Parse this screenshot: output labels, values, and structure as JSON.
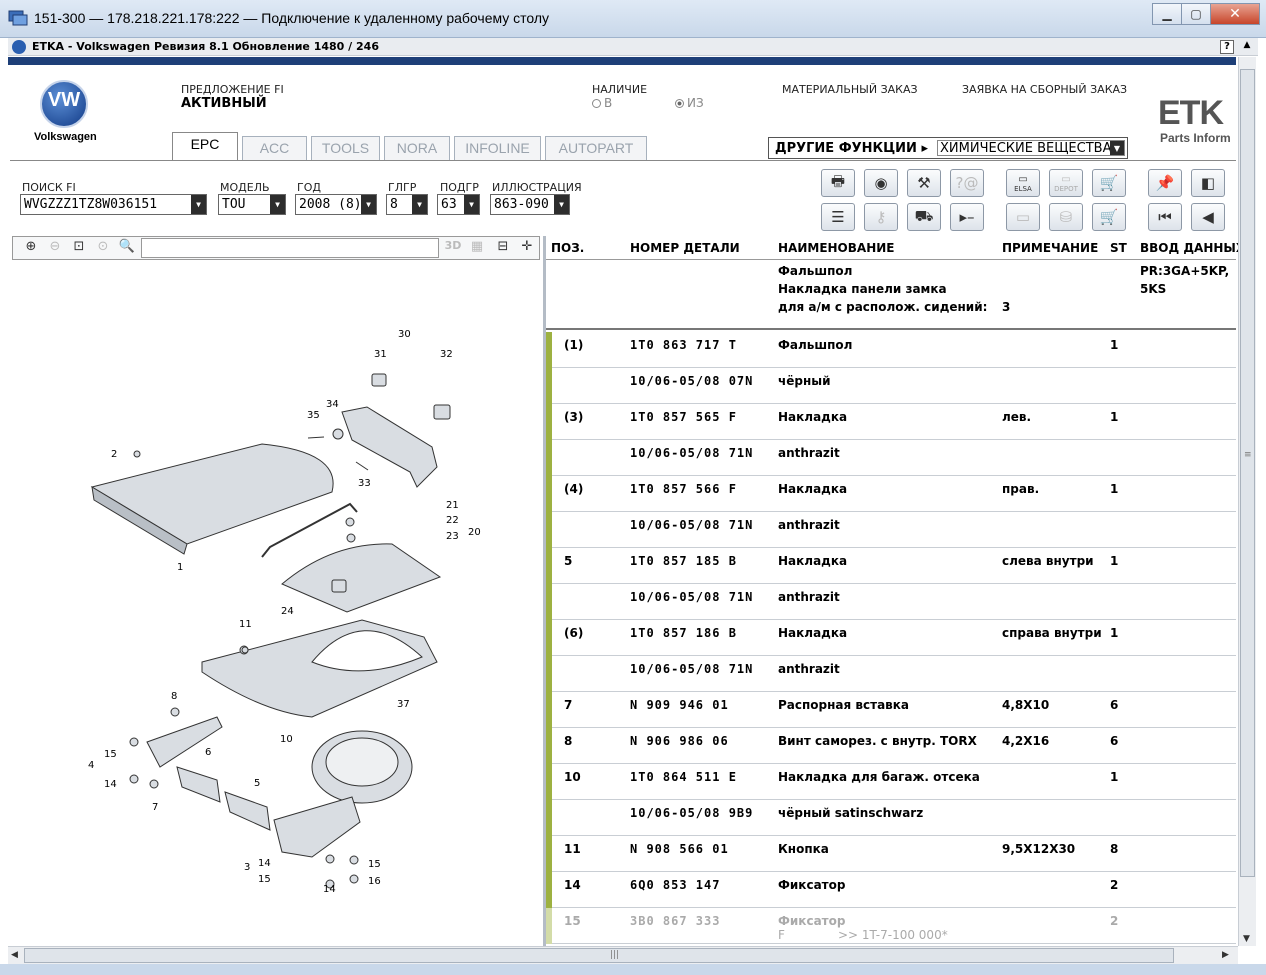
{
  "window": {
    "title": "151-300 — 178.218.221.178:222 — Подключение к удаленному рабочему столу",
    "minimize": "▁",
    "maximize": "▢",
    "close": "✕"
  },
  "app": {
    "title": "ETKA - Volkswagen Ревизия 8.1 Обновление 1480 / 246",
    "help": "?",
    "brand": "Volkswagen",
    "logo_letters": "VW",
    "etk_logo": "ETK",
    "etk_sub": "Parts Inform",
    "accent_color": "#1e3f78",
    "row_marker_color": "#9db141"
  },
  "header": {
    "offer_label": "ПРЕДЛОЖЕНИЕ FI",
    "offer_value": "АКТИВНЫЙ",
    "availability_label": "НАЛИЧИЕ",
    "availability_in": "В",
    "availability_from": "ИЗ",
    "material_order": "МАТЕРИАЛЬНЫЙ ЗАКАЗ",
    "assembly_order": "ЗАЯВКА НА СБОРНЫЙ ЗАКАЗ"
  },
  "tabs": [
    {
      "label": "EPC"
    },
    {
      "label": "ACC"
    },
    {
      "label": "TOOLS"
    },
    {
      "label": "NORA"
    },
    {
      "label": "INFOLINE"
    },
    {
      "label": "AUTOPART"
    }
  ],
  "other_functions": {
    "label": "ДРУГИЕ ФУНКЦИИ",
    "selected": "ХИМИЧЕСКИЕ ВЕЩЕСТВА"
  },
  "filters": {
    "search_fi_label": "ПОИСК FI",
    "search_fi_value": "WVGZZZ1TZ8W036151",
    "model_label": "МОДЕЛЬ",
    "model_value": "TOU",
    "year_label": "ГОД",
    "year_value": "2008 (8)",
    "main_group_label": "ГЛГР",
    "main_group_value": "8",
    "subgroup_label": "ПОДГР",
    "subgroup_value": "63",
    "illustration_label": "ИЛЛЮСТРАЦИЯ",
    "illustration_value": "863-090"
  },
  "toolbar": {
    "elsa": "ELSA",
    "depot": "DEPOT"
  },
  "illustration_toolbar": {
    "label_3d": "3D"
  },
  "table": {
    "columns": [
      "ПОЗ.",
      "НОМЕР ДЕТАЛИ",
      "НАИМЕНОВАНИЕ",
      "ПРИМЕЧАНИЕ",
      "ST",
      "ВВОД ДАННЫХ"
    ],
    "description": {
      "line1": "Фальшпол",
      "line2": "Накладка панели замка",
      "line3": "для а/м с располож. сидений:",
      "count": "3",
      "model_data_1": "PR:3GA+5KP,",
      "model_data_2": "5KS"
    },
    "rows": [
      {
        "pos": "(1)",
        "part": "1T0 863 717  T",
        "name": "Фальшпол",
        "note": "",
        "qty": "1"
      },
      {
        "pos": "",
        "part": "10/06-05/08 07N",
        "name": "чёрный",
        "note": "",
        "qty": ""
      },
      {
        "pos": "(3)",
        "part": "1T0 857 565  F",
        "name": "Накладка",
        "note": "лев.",
        "qty": "1"
      },
      {
        "pos": "",
        "part": "10/06-05/08 71N",
        "name": "anthrazit",
        "note": "",
        "qty": ""
      },
      {
        "pos": "(4)",
        "part": "1T0 857 566  F",
        "name": "Накладка",
        "note": "прав.",
        "qty": "1"
      },
      {
        "pos": "",
        "part": "10/06-05/08 71N",
        "name": "anthrazit",
        "note": "",
        "qty": ""
      },
      {
        "pos": "5",
        "part": "1T0 857 185  B",
        "name": "Накладка",
        "note": "слева внутри",
        "qty": "1"
      },
      {
        "pos": "",
        "part": "10/06-05/08 71N",
        "name": "anthrazit",
        "note": "",
        "qty": ""
      },
      {
        "pos": "(6)",
        "part": "1T0 857 186  B",
        "name": "Накладка",
        "note": "справа внутри",
        "qty": "1"
      },
      {
        "pos": "",
        "part": "10/06-05/08 71N",
        "name": "anthrazit",
        "note": "",
        "qty": ""
      },
      {
        "pos": "7",
        "part": "N    909 946 01",
        "name": "Распорная вставка",
        "note": "4,8X10",
        "qty": "6"
      },
      {
        "pos": "8",
        "part": "N    906 986 06",
        "name": "Винт саморез. с внутр. TORX",
        "note": "4,2X16",
        "qty": "6"
      },
      {
        "pos": "10",
        "part": "1T0 864 511  E",
        "name": "Накладка для багаж. отсека",
        "note": "",
        "qty": "1"
      },
      {
        "pos": "",
        "part": "10/06-05/08 9B9",
        "name": "чёрный satinschwarz",
        "note": "",
        "qty": ""
      },
      {
        "pos": "11",
        "part": "N    908 566 01",
        "name": "Кнопка",
        "note": "9,5X12X30",
        "qty": "8"
      },
      {
        "pos": "14",
        "part": "6Q0 853 147",
        "name": "Фиксатор",
        "note": "",
        "qty": "2"
      },
      {
        "pos": "15",
        "part": "3B0 867 333",
        "name": "Фиксатор",
        "note": "",
        "qty": "2"
      }
    ],
    "footer_f": "F",
    "footer_ref": ">> 1T-7-100 000*"
  },
  "diagram_labels": [
    "30",
    "31",
    "32",
    "34",
    "35",
    "2",
    "33",
    "21",
    "22",
    "23",
    "20",
    "1",
    "24",
    "11",
    "10",
    "37",
    "8",
    "15",
    "6",
    "4",
    "14",
    "7",
    "5",
    "3",
    "14",
    "15",
    "14",
    "15",
    "16"
  ]
}
